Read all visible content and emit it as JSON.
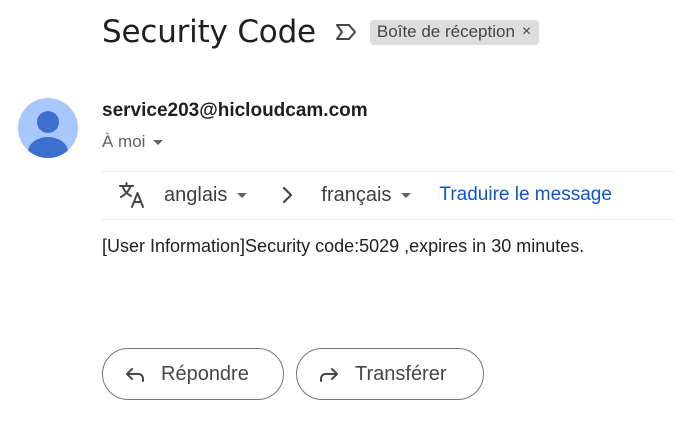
{
  "email": {
    "subject": "Security Code",
    "label": "Boîte de réception",
    "label_remove": "×",
    "sender": "service203@hicloudcam.com",
    "recipient": "À moi",
    "body": "[User Information]Security code:5029 ,expires in 30 minutes."
  },
  "translate": {
    "source_lang": "anglais",
    "target_lang": "français",
    "translate_link": "Traduire le message"
  },
  "actions": {
    "reply": "Répondre",
    "forward": "Transférer"
  },
  "icons": {
    "important": "important-marker-icon",
    "avatar": "person-avatar-icon",
    "translate": "translate-icon",
    "separator": "chevron-right-icon",
    "reply": "reply-icon",
    "forward": "forward-icon"
  },
  "colors": {
    "avatar_bg": "#a8c7fa",
    "avatar_fg": "#3c6fcf",
    "link": "#0b57d0",
    "chip_bg": "#dddddd"
  }
}
